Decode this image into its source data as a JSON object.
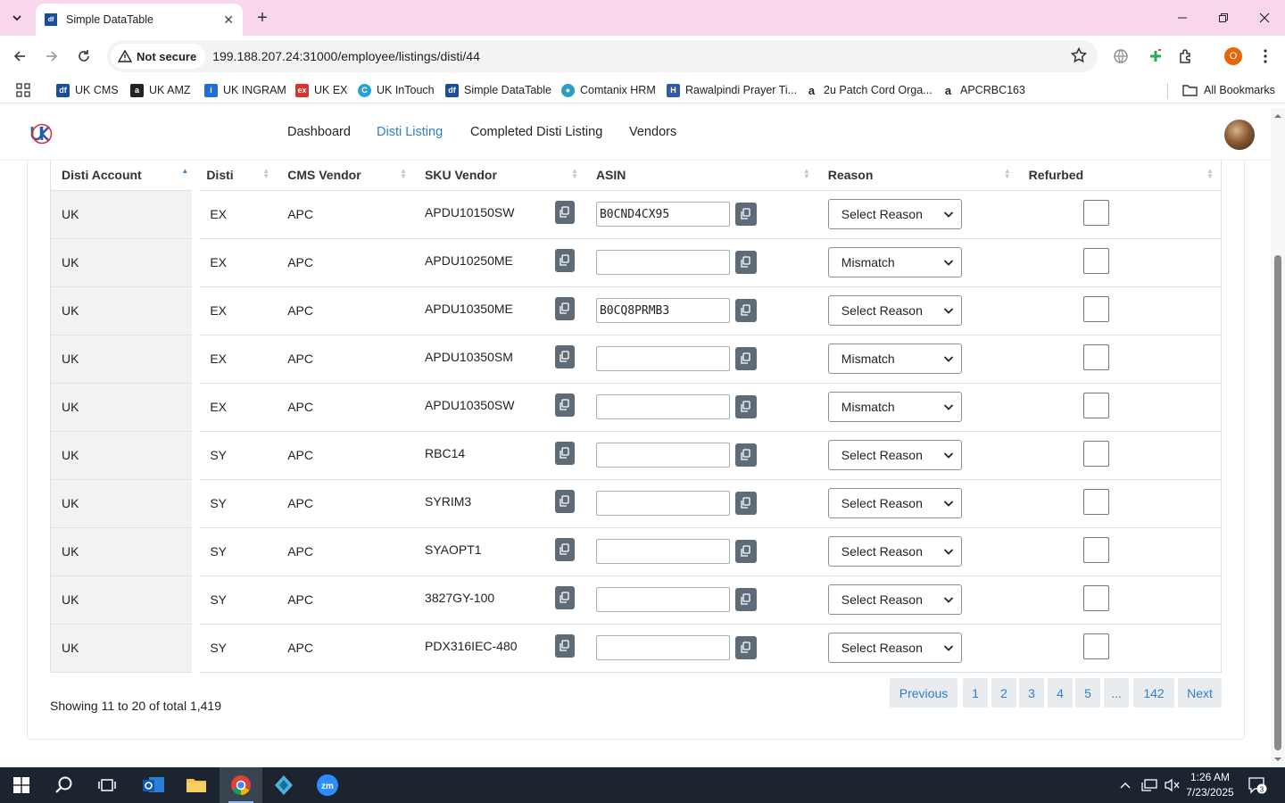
{
  "browser": {
    "tab_title": "Simple DataTable",
    "security_label": "Not secure",
    "url": "199.188.207.24:31000/employee/listings/disti/44",
    "profile_initial": "O",
    "bookmarks": [
      {
        "label": "UK CMS",
        "icon": "df-icon",
        "color": "#1a4d9c"
      },
      {
        "label": "UK AMZ",
        "icon": "amazon-icon",
        "color": "#222222"
      },
      {
        "label": "UK INGRAM",
        "icon": "ingram-icon",
        "color": "#1e6fd9"
      },
      {
        "label": "UK EX",
        "icon": "ex-icon",
        "color": "#d9332b"
      },
      {
        "label": "UK InTouch",
        "icon": "intouch-icon",
        "color": "#2aa0d8"
      },
      {
        "label": "Simple DataTable",
        "icon": "df-icon",
        "color": "#1a4d9c"
      },
      {
        "label": "Comtanix HRM",
        "icon": "hrm-icon",
        "color": "#2a9dc0"
      },
      {
        "label": "Rawalpindi Prayer Ti...",
        "icon": "prayer-icon",
        "color": "#2e5aa8"
      },
      {
        "label": "2u Patch Cord Orga...",
        "icon": "amazon-icon",
        "color": "#222222"
      },
      {
        "label": "APCRBC163",
        "icon": "amazon-icon",
        "color": "#222222"
      }
    ],
    "all_bookmarks": "All Bookmarks"
  },
  "nav": {
    "links": [
      "Dashboard",
      "Disti Listing",
      "Completed Disti Listing",
      "Vendors"
    ],
    "active": "Disti Listing"
  },
  "table": {
    "columns": [
      "Disti Account",
      "Disti",
      "CMS Vendor",
      "SKU Vendor",
      "ASIN",
      "Reason",
      "Refurbed"
    ],
    "sorted_column": "Disti Account",
    "rows": [
      {
        "account": "UK",
        "disti": "EX",
        "vendor": "APC",
        "sku": "APDU10150SW",
        "asin": "B0CND4CX95",
        "reason": "Select Reason",
        "refurbed": false
      },
      {
        "account": "UK",
        "disti": "EX",
        "vendor": "APC",
        "sku": "APDU10250ME",
        "asin": "",
        "reason": "Mismatch",
        "refurbed": false
      },
      {
        "account": "UK",
        "disti": "EX",
        "vendor": "APC",
        "sku": "APDU10350ME",
        "asin": "B0CQ8PRMB3",
        "reason": "Select Reason",
        "refurbed": false
      },
      {
        "account": "UK",
        "disti": "EX",
        "vendor": "APC",
        "sku": "APDU10350SM",
        "asin": "",
        "reason": "Mismatch",
        "refurbed": false
      },
      {
        "account": "UK",
        "disti": "EX",
        "vendor": "APC",
        "sku": "APDU10350SW",
        "asin": "",
        "reason": "Mismatch",
        "refurbed": false
      },
      {
        "account": "UK",
        "disti": "SY",
        "vendor": "APC",
        "sku": "RBC14",
        "asin": "",
        "reason": "Select Reason",
        "refurbed": false
      },
      {
        "account": "UK",
        "disti": "SY",
        "vendor": "APC",
        "sku": "SYRIM3",
        "asin": "",
        "reason": "Select Reason",
        "refurbed": false
      },
      {
        "account": "UK",
        "disti": "SY",
        "vendor": "APC",
        "sku": "SYAOPT1",
        "asin": "",
        "reason": "Select Reason",
        "refurbed": false
      },
      {
        "account": "UK",
        "disti": "SY",
        "vendor": "APC",
        "sku": "3827GY-100",
        "asin": "",
        "reason": "Select Reason",
        "refurbed": false
      },
      {
        "account": "UK",
        "disti": "SY",
        "vendor": "APC",
        "sku": "PDX316IEC-480",
        "asin": "",
        "reason": "Select Reason",
        "refurbed": false
      }
    ]
  },
  "footer": {
    "info": "Showing 11 to 20 of total 1,419",
    "pagination": [
      "Previous",
      "1",
      "2",
      "3",
      "4",
      "5",
      "...",
      "142",
      "Next"
    ]
  },
  "taskbar": {
    "time": "1:26 AM",
    "date": "7/23/2025",
    "notification_count": "3"
  }
}
